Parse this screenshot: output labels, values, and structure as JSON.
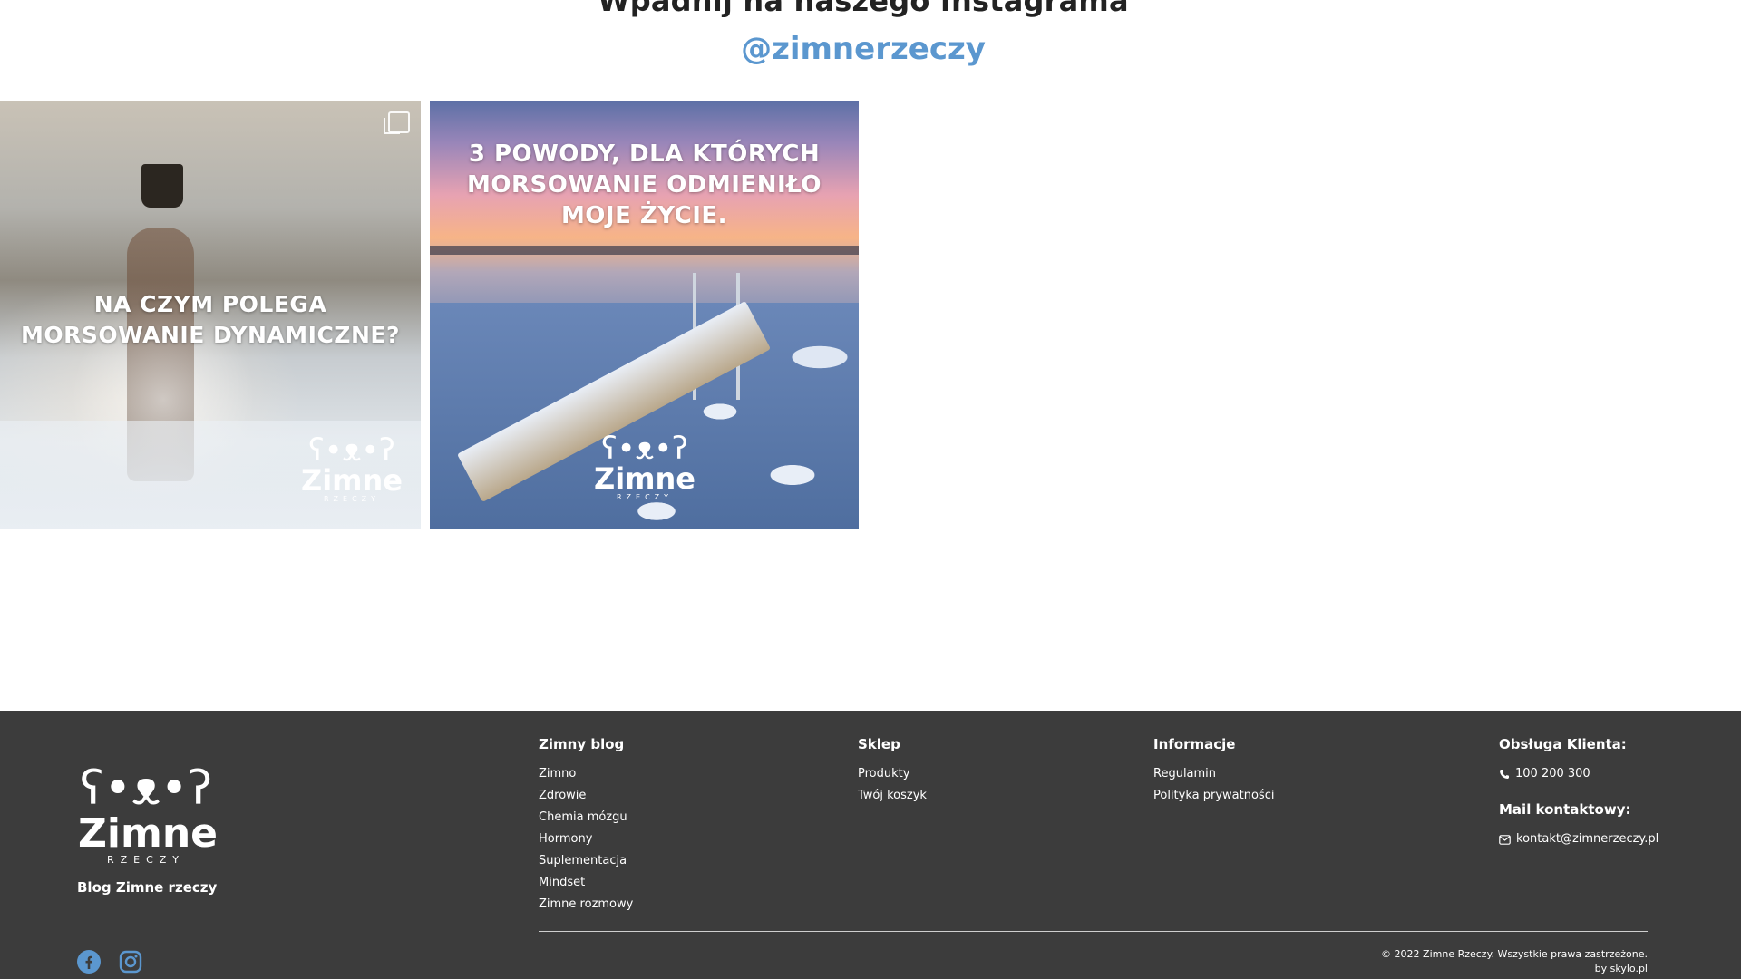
{
  "instagram": {
    "heading": "Wpadnij na naszego Instagrama",
    "handle": "@zimnerzeczy",
    "posts": [
      {
        "text": "NA CZYM POLEGA MORSOWANIE DYNAMICZNE?",
        "logo_word": "Zimne",
        "logo_sub": "RZECZY"
      },
      {
        "text": "3 POWODY, DLA KTÓRYCH MORSOWANIE ODMIENIŁO MOJE ŻYCIE.",
        "logo_word": "Zimne",
        "logo_sub": "RZECZY"
      }
    ]
  },
  "footer": {
    "logo_word": "Zimne",
    "logo_sub": "RZECZY",
    "blog_name": "Blog Zimne rzeczy",
    "social_icons": [
      "facebook-icon",
      "instagram-icon"
    ],
    "columns": {
      "blog": {
        "title": "Zimny blog",
        "items": [
          "Zimno",
          "Zdrowie",
          "Chemia mózgu",
          "Hormony",
          "Suplementacja",
          "Mindset",
          "Zimne rozmowy"
        ]
      },
      "shop": {
        "title": "Sklep",
        "items": [
          "Produkty",
          "Twój koszyk"
        ]
      },
      "info": {
        "title": "Informacje",
        "items": [
          "Regulamin",
          "Polityka prywatności"
        ]
      },
      "contact": {
        "title": "Obsługa Klienta:",
        "phone": "100 200 300",
        "mail_title": "Mail kontaktowy:",
        "email": "kontakt@zimnerzeczy.pl"
      }
    },
    "copyright": "© 2022 Zimne Rzeczy. Wszystkie prawa zastrzeżone.",
    "credit": "by skylo.pl"
  },
  "colors": {
    "accent": "#5b97cf",
    "footer_bg": "#3c3c3c"
  }
}
